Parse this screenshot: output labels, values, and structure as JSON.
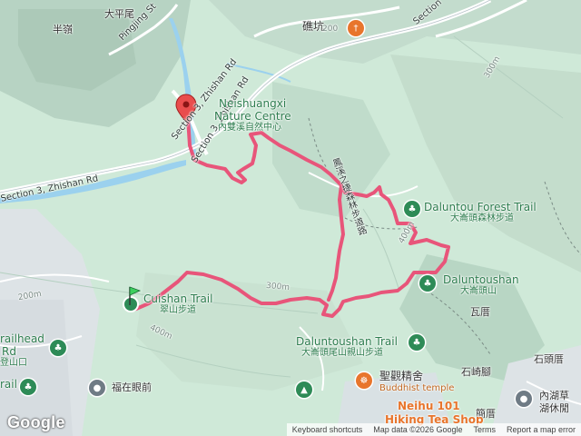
{
  "map": {
    "labels": {
      "banling": "半嶺",
      "dapingwei": "大平尾",
      "pingjing_st": "Pingjing St",
      "section3_zhishan_upper": "Section 3, Zhishan Rd",
      "section3_zhishan_left": "Section 3, Zhishan Rd",
      "section3_zhishan_mid": "Section 3, Zhishan Rd",
      "dingkeng": "礁坑",
      "section_topright": "Section",
      "elev_200_top": "200",
      "elev_300_right": "300m",
      "neishuangxi_en_1": "Neishuangxi",
      "neishuangxi_en_2": "Nature Centre",
      "neishuangxi_zh": "內雙溪自然中心",
      "fenglian_zh": "鳳溪之捷森林步道路",
      "daluntou_forest_en": "Daluntou Forest Trail",
      "daluntou_forest_zh": "大崙頭森林步道",
      "daluntoushan_en": "Daluntoushan",
      "daluntoushan_zh": "大崙頭山",
      "wali": "瓦厝",
      "shitouli": "石頭厝",
      "cuishan_en": "Cuishan Trail",
      "cuishan_zh": "翠山步道",
      "elev_300_mid": "300m",
      "elev_200_left": "200m",
      "elev_400_left": "400m",
      "elev_400_right": "400m",
      "trailhead_en_1": "railhead",
      "trailhead_en_2": "Rd",
      "trailhead_zh": "登山口",
      "trail_left": "rail",
      "daluntou_tail_en": "Daluntoushan Trail",
      "daluntou_tail_zh": "大崙頭尾山親山步道",
      "fuzai": "福在眼前",
      "shengguan_zh": "聖觀精舍",
      "shengguan_en": "Buddhist temple",
      "shiqijiao": "石崎腳",
      "neihu_1": "內湖草",
      "neihu_2": "湖休閒",
      "jianli": "簡厝",
      "neihu101_1": "Neihu 101",
      "neihu101_2": "Hiking Tea Shop"
    },
    "icons": {
      "start_marker": "green-flag-pin",
      "end_marker": "red-pin",
      "restaurant": "fork-knife-icon",
      "park": "tree-icon",
      "camp": "tent-icon",
      "temple": "dharma-wheel-icon"
    },
    "colors": {
      "land": "#cfe9d8",
      "terrain_dark": "#a9c6b5",
      "urban": "#dde3e6",
      "water": "#9bd1ee",
      "road": "#ffffff",
      "track": "#e8557a"
    }
  },
  "footer": {
    "logo": "Google",
    "keyboard": "Keyboard shortcuts",
    "mapdata": "Map data ©2026 Google",
    "terms": "Terms",
    "report": "Report a map error"
  }
}
